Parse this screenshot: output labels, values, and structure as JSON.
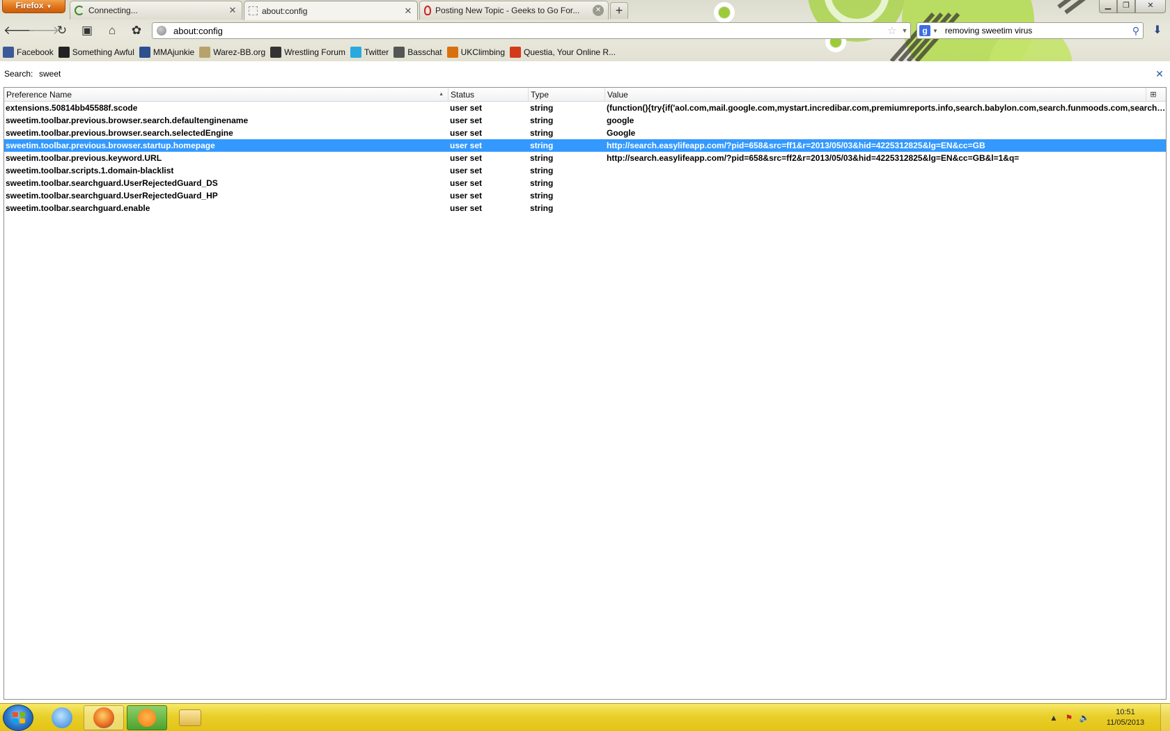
{
  "browser": {
    "app_button": "Firefox",
    "tabs": [
      {
        "title": "Connecting...",
        "active": false
      },
      {
        "title": "about:config",
        "active": true
      },
      {
        "title": "Posting New Topic - Geeks to Go For...",
        "active": false
      }
    ],
    "url": "about:config",
    "search_engine_letter": "g",
    "search_text": "removing sweetim virus",
    "bookmarks": [
      {
        "label": "Facebook",
        "icon": "facebook-icon",
        "color": "#3b5998"
      },
      {
        "label": "Something Awful",
        "icon": "grenade-icon",
        "color": "#222222"
      },
      {
        "label": "MMAjunkie",
        "icon": "mmajunkie-icon",
        "color": "#2b4f8f"
      },
      {
        "label": "Warez-BB.org",
        "icon": "warez-icon",
        "color": "#b7a26b"
      },
      {
        "label": "Wrestling Forum",
        "icon": "wrestling-icon",
        "color": "#333333"
      },
      {
        "label": "Twitter",
        "icon": "twitter-icon",
        "color": "#2aa9e0"
      },
      {
        "label": "Basschat",
        "icon": "basschat-icon",
        "color": "#555555"
      },
      {
        "label": "UKClimbing",
        "icon": "ukclimbing-icon",
        "color": "#d9700f"
      },
      {
        "label": "Questia, Your Online R...",
        "icon": "questia-icon",
        "color": "#d33a1a"
      }
    ]
  },
  "config": {
    "search_label": "Search:",
    "search_value": "sweet",
    "columns": {
      "name": "Preference Name",
      "status": "Status",
      "type": "Type",
      "value": "Value"
    },
    "rows": [
      {
        "name": "extensions.50814bb45588f.scode",
        "status": "user set",
        "type": "string",
        "value": "(function(){try{if('aol.com,mail.google.com,mystart.incredibar.com,premiumreports.info,search.babylon.com,search.funmoods.com,search.gbo..."
      },
      {
        "name": "sweetim.toolbar.previous.browser.search.defaultenginename",
        "status": "user set",
        "type": "string",
        "value": "google"
      },
      {
        "name": "sweetim.toolbar.previous.browser.search.selectedEngine",
        "status": "user set",
        "type": "string",
        "value": "Google"
      },
      {
        "name": "sweetim.toolbar.previous.browser.startup.homepage",
        "status": "user set",
        "type": "string",
        "value": "http://search.easylifeapp.com/?pid=658&src=ff1&r=2013/05/03&hid=4225312825&lg=EN&cc=GB",
        "selected": true
      },
      {
        "name": "sweetim.toolbar.previous.keyword.URL",
        "status": "user set",
        "type": "string",
        "value": "http://search.easylifeapp.com/?pid=658&src=ff2&r=2013/05/03&hid=4225312825&lg=EN&cc=GB&l=1&q="
      },
      {
        "name": "sweetim.toolbar.scripts.1.domain-blacklist",
        "status": "user set",
        "type": "string",
        "value": ""
      },
      {
        "name": "sweetim.toolbar.searchguard.UserRejectedGuard_DS",
        "status": "user set",
        "type": "string",
        "value": ""
      },
      {
        "name": "sweetim.toolbar.searchguard.UserRejectedGuard_HP",
        "status": "user set",
        "type": "string",
        "value": ""
      },
      {
        "name": "sweetim.toolbar.searchguard.enable",
        "status": "user set",
        "type": "string",
        "value": ""
      }
    ]
  },
  "taskbar": {
    "time": "10:51",
    "date": "11/05/2013"
  },
  "colors": {
    "selection": "#3399ff",
    "taskbar": "#e9cf2a",
    "firefox_button": "#e2731a"
  }
}
